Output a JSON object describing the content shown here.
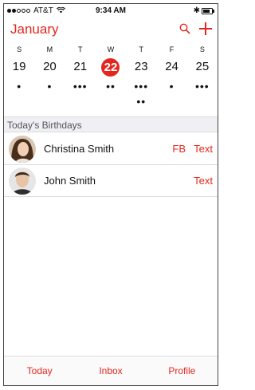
{
  "status_bar": {
    "carrier": "AT&T",
    "time": "9:34 AM",
    "bluetooth": "✱"
  },
  "header": {
    "month": "January",
    "icons": [
      "search-icon",
      "add-icon"
    ]
  },
  "week": {
    "days_of_week": [
      "S",
      "M",
      "T",
      "W",
      "T",
      "F",
      "S"
    ],
    "dates": [
      "19",
      "20",
      "21",
      "22",
      "23",
      "24",
      "25"
    ],
    "selected": "22",
    "event_dots": [
      "•",
      "•",
      "•••",
      "••",
      "•••",
      "•",
      "•••"
    ],
    "event_dots_row2": [
      "",
      "",
      "",
      "",
      "••",
      "",
      ""
    ]
  },
  "birthdays": {
    "header": "Today's Birthdays",
    "rows": [
      {
        "name": "Christina Smith",
        "actions": [
          "FB",
          "Text"
        ]
      },
      {
        "name": "John Smith",
        "actions": [
          "Text"
        ]
      }
    ]
  },
  "tabbar": {
    "tabs": [
      "Today",
      "Inbox",
      "Profile"
    ]
  },
  "colors": {
    "accent": "#e3271f",
    "section_bg": "#efeff4"
  }
}
